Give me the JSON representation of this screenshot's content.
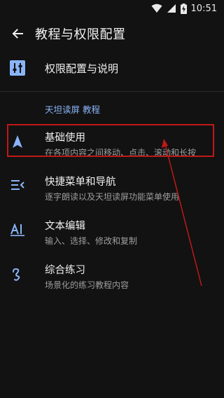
{
  "status": {
    "time": "10:51"
  },
  "header": {
    "title": "教程与权限配置"
  },
  "settings_row": {
    "label": "权限配置与说明"
  },
  "section": {
    "title": "天坦读屏 教程"
  },
  "items": [
    {
      "title": "基础使用",
      "subtitle": "在各项内容之间移动、点击、滚动和长按",
      "icon": "navigation-arrow-icon"
    },
    {
      "title": "快捷菜单和导航",
      "subtitle": "逐字朗读以及天坦读屏功能菜单使用",
      "icon": "menu-list-icon"
    },
    {
      "title": "文本编辑",
      "subtitle": "输入、选择、修改和复制",
      "icon": "text-edit-icon"
    },
    {
      "title": "综合练习",
      "subtitle": "场景化的练习教程内容",
      "icon": "gesture-icon"
    }
  ],
  "colors": {
    "accent": "#8ab4f8",
    "annotation": "#c01818"
  }
}
